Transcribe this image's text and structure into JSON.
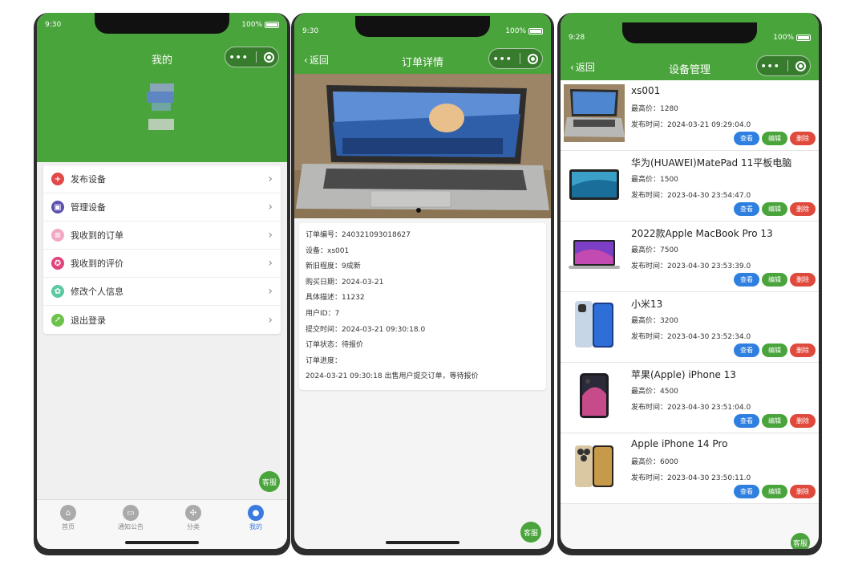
{
  "colors": {
    "brand_green": "#4aa43c",
    "view_blue": "#2f7fe0",
    "delete_red": "#e04a3c",
    "active_tab_blue": "#3b7be0"
  },
  "phone1": {
    "time": "9:30",
    "battery": "100%",
    "title": "我的",
    "menu": [
      {
        "label": "发布设备",
        "icon": "plus-icon",
        "color": "#e24a4a"
      },
      {
        "label": "管理设备",
        "icon": "save-icon",
        "color": "#5b4fb0"
      },
      {
        "label": "我收到的订单",
        "icon": "document-icon",
        "color": "#f1a8c4"
      },
      {
        "label": "我收到的评价",
        "icon": "badge-icon",
        "color": "#e0437c"
      },
      {
        "label": "修改个人信息",
        "icon": "settings-icon",
        "color": "#5cc9a0"
      },
      {
        "label": "退出登录",
        "icon": "leaf-icon",
        "color": "#6cc24a"
      }
    ],
    "kefu": "客服",
    "tabs": [
      {
        "label": "首页",
        "icon": "home-icon"
      },
      {
        "label": "通知公告",
        "icon": "message-icon"
      },
      {
        "label": "分类",
        "icon": "category-icon"
      },
      {
        "label": "我的",
        "icon": "user-icon",
        "active": true
      }
    ]
  },
  "phone2": {
    "time": "9:30",
    "battery": "100%",
    "back": "返回",
    "title": "订单详情",
    "fields": [
      "订单编号：240321093018627",
      "设备：xs001",
      "新旧程度：9成新",
      "购买日期：2024-03-21",
      "具体描述：11232",
      "用户ID：7",
      "提交时间：2024-03-21 09:30:18.0",
      "订单状态：待报价",
      "订单进度：",
      "2024-03-21 09:30:18 出售用户提交订单，等待报价"
    ],
    "kefu": "客服"
  },
  "phone3": {
    "time": "9:28",
    "battery": "100%",
    "back": "返回",
    "title": "设备管理",
    "price_prefix": "最高价：",
    "time_prefix": "发布时间：",
    "btn_view": "查看",
    "btn_edit": "编辑",
    "btn_delete": "删除",
    "devices": [
      {
        "name": "xs001",
        "price": "最高价：1280",
        "time": "发布时间：2024-03-21 09:29:04.0",
        "kind": "laptop-photo"
      },
      {
        "name": "华为(HUAWEI)MatePad 11平板电脑",
        "price": "最高价：1500",
        "time": "发布时间：2023-04-30 23:54:47.0",
        "kind": "tablet"
      },
      {
        "name": "2022款Apple MacBook Pro 13",
        "price": "最高价：7500",
        "time": "发布时间：2023-04-30 23:53:39.0",
        "kind": "macbook"
      },
      {
        "name": "小米13",
        "price": "最高价：3200",
        "time": "发布时间：2023-04-30 23:52:34.0",
        "kind": "phone-blue"
      },
      {
        "name": "苹果(Apple) iPhone 13",
        "price": "最高价：4500",
        "time": "发布时间：2023-04-30 23:51:04.0",
        "kind": "phone-dark"
      },
      {
        "name": "Apple iPhone 14 Pro",
        "price": "最高价：6000",
        "time": "发布时间：2023-04-30 23:50:11.0",
        "kind": "phone-gold"
      }
    ],
    "kefu": "客服"
  }
}
